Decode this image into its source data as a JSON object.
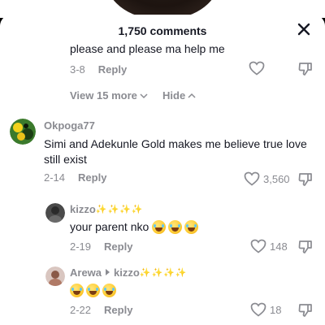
{
  "header": {
    "title": "1,750 comments"
  },
  "comments": [
    {
      "text": "please and please ma help me",
      "date": "3-8",
      "reply_label": "Reply",
      "likes": ""
    },
    {
      "username": "Okpoga77",
      "text": "Simi and Adekunle Gold makes me believe true love still exist",
      "date": "2-14",
      "reply_label": "Reply",
      "likes": "3,560"
    }
  ],
  "thread_controls": {
    "view_more": "View 15 more",
    "hide": "Hide"
  },
  "replies": [
    {
      "username": "kizzo",
      "sparkles": "✨✨✨✨",
      "text": "your parent nko",
      "emoji_count": 3,
      "date": "2-19",
      "reply_label": "Reply",
      "likes": "148"
    },
    {
      "username": "Arewa",
      "reply_to": "kizzo",
      "sparkles": "✨✨✨✨",
      "emoji_count": 3,
      "date": "2-22",
      "reply_label": "Reply",
      "likes": "18"
    }
  ],
  "icons": {
    "close": "close-icon",
    "heart": "heart-icon",
    "dislike": "dislike-icon",
    "chevron_down": "chevron-down-icon",
    "chevron_up": "chevron-up-icon",
    "emoji": "laughing-emoji-icon"
  },
  "colors": {
    "text": "#161823",
    "muted": "#8a8b91",
    "sparkle": "#f2c511"
  }
}
